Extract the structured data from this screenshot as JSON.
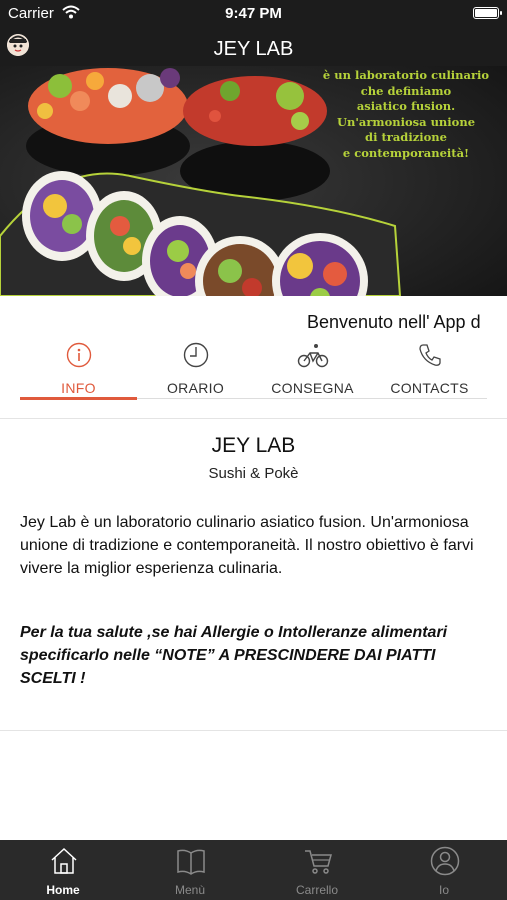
{
  "status_bar": {
    "carrier": "Carrier",
    "time": "9:47 PM"
  },
  "header": {
    "title": "JEY LAB"
  },
  "hero": {
    "tagline_lines": [
      "è un laboratorio culinario",
      "che definiamo",
      "asiatico fusion.",
      "Un'armoniosa unione",
      "di tradizione",
      "e contemporaneità!"
    ]
  },
  "welcome_text": "Benvenuto nell' App d",
  "tabs": [
    {
      "label": "INFO",
      "icon": "info-icon",
      "active": true
    },
    {
      "label": "ORARIO",
      "icon": "clock-icon",
      "active": false
    },
    {
      "label": "CONSEGNA",
      "icon": "bicycle-icon",
      "active": false
    },
    {
      "label": "CONTACTS",
      "icon": "phone-icon",
      "active": false
    }
  ],
  "restaurant": {
    "name": "JEY LAB",
    "subtitle": "Sushi & Pokè",
    "description": "Jey Lab è un laboratorio culinario asiatico fusion. Un'armoniosa unione di tradizione e contemporaneità. Il nostro obiettivo è farvi vivere la miglior esperienza culinaria.",
    "notice": "Per la tua salute ,se hai Allergie o Intolleranze alimentari specificarlo nelle “NOTE” A PRESCINDERE DAI PIATTI SCELTI !"
  },
  "tab_bar": [
    {
      "label": "Home",
      "icon": "home-icon",
      "active": true
    },
    {
      "label": "Menù",
      "icon": "book-icon",
      "active": false
    },
    {
      "label": "Carrello",
      "icon": "cart-icon",
      "active": false
    },
    {
      "label": "Io",
      "icon": "user-icon",
      "active": false
    }
  ],
  "colors": {
    "accent": "#e05a3c",
    "bar_background": "#1c1c1c",
    "tagline": "#b6d23a"
  }
}
